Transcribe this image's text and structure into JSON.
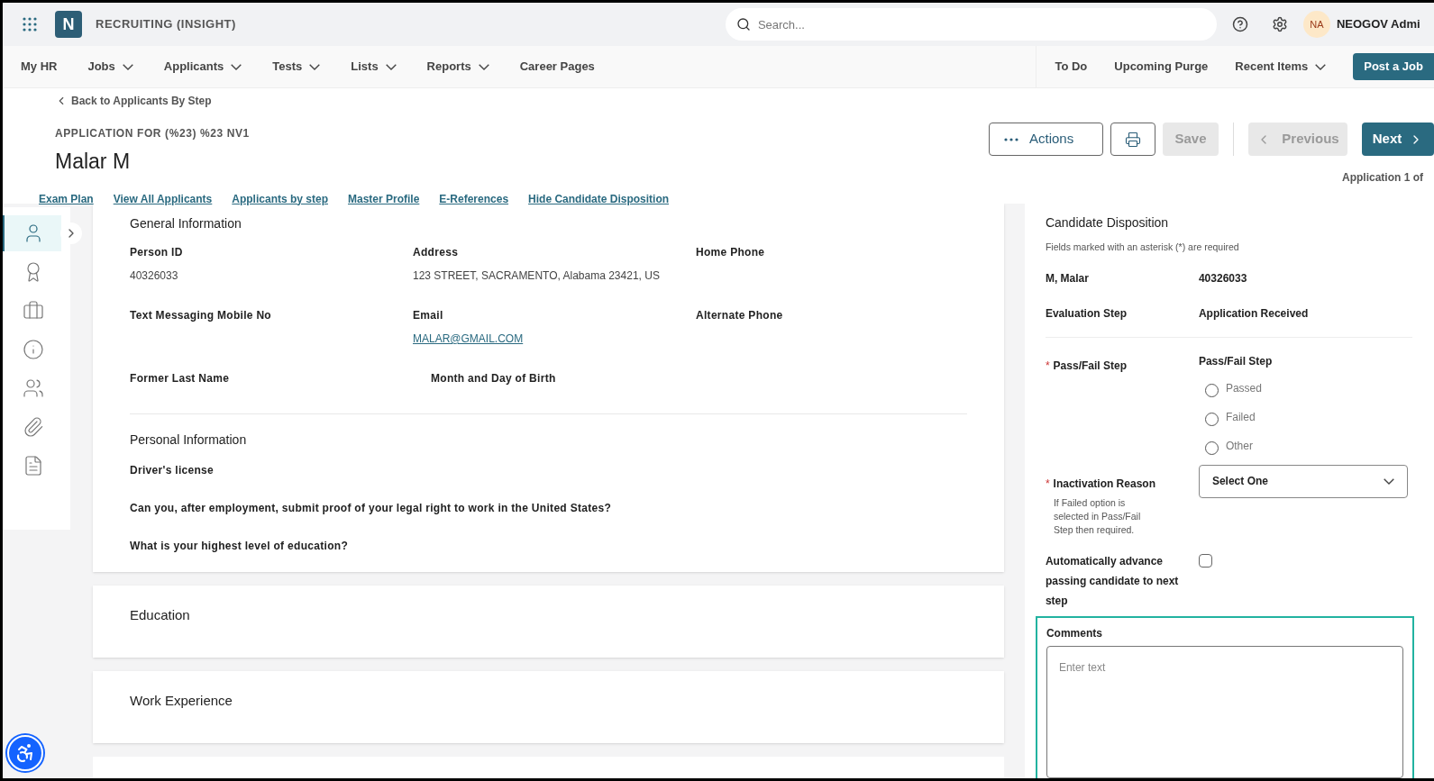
{
  "header": {
    "logo": "N",
    "app_title": "RECRUITING (INSIGHT)",
    "search": {
      "placeholder": "Search..."
    },
    "avatar": "NA",
    "user_name": "NEOGOV Admi"
  },
  "nav": {
    "left": [
      {
        "label": "My HR",
        "dropdown": false
      },
      {
        "label": "Jobs",
        "dropdown": true
      },
      {
        "label": "Applicants",
        "dropdown": true
      },
      {
        "label": "Tests",
        "dropdown": true
      },
      {
        "label": "Lists",
        "dropdown": true
      },
      {
        "label": "Reports",
        "dropdown": true
      },
      {
        "label": "Career Pages",
        "dropdown": false
      }
    ],
    "right": [
      {
        "label": "To Do",
        "dropdown": false
      },
      {
        "label": "Upcoming Purge",
        "dropdown": false
      },
      {
        "label": "Recent Items",
        "dropdown": true
      }
    ],
    "post_button": "Post a Job"
  },
  "page": {
    "back_link": "Back to Applicants By Step",
    "subtitle": "APPLICATION FOR (%23) %23 NV1",
    "name": "Malar M",
    "buttons": [
      {
        "kind": "actions",
        "label": "Actions",
        "disabled": false
      },
      {
        "kind": "print",
        "disabled": false
      },
      {
        "kind": "save",
        "label": "Save",
        "disabled": true
      },
      {
        "kind": "previous",
        "label": "Previous",
        "disabled": true
      },
      {
        "kind": "next",
        "label": "Next",
        "disabled": false
      }
    ],
    "counter": "Application 1 of",
    "links": [
      "Exam Plan",
      "View All Applicants",
      "Applicants by step",
      "Master Profile",
      "E-References",
      "Hide Candidate Disposition"
    ]
  },
  "sidebar": {
    "items": [
      {
        "kind": "person",
        "selected": true
      },
      {
        "kind": "award",
        "selected": false
      },
      {
        "kind": "briefcase",
        "selected": false
      },
      {
        "kind": "info",
        "selected": false
      },
      {
        "kind": "people",
        "selected": false
      },
      {
        "kind": "paperclip",
        "selected": false
      },
      {
        "kind": "document",
        "selected": false
      }
    ]
  },
  "general": {
    "title": "General Information",
    "rows": [
      [
        {
          "label": "Person ID",
          "value": "40326033"
        },
        {
          "label": "Address",
          "value": "123 STREET, SACRAMENTO, Alabama 23421, US"
        },
        {
          "label": "Home Phone"
        }
      ],
      [
        {
          "label": "Text Messaging Mobile No"
        },
        {
          "label": "Email",
          "link": "MALAR@GMAIL.COM"
        },
        {
          "label": "Alternate Phone"
        }
      ],
      [
        {
          "label": "Former Last Name"
        },
        {
          "label": "Month and Day of Birth"
        }
      ]
    ]
  },
  "personal": {
    "title": "Personal Information",
    "questions": [
      "Driver's license",
      "Can you, after employment, submit proof of your legal right to work in the United States?",
      "What is your highest level of education?"
    ]
  },
  "sections": [
    "Education",
    "Work Experience"
  ],
  "disposition": {
    "title": "Candidate Disposition",
    "note": "Fields marked with an asterisk (*) are required",
    "candidate_name": "M, Malar",
    "candidate_id": "40326033",
    "step_label": "Evaluation Step",
    "step_value": "Application Received",
    "pass_fail": {
      "label": "Pass/Fail Step",
      "required_mark": "*",
      "heading": "Pass/Fail Step",
      "options": [
        {
          "label": "Passed",
          "selected": false
        },
        {
          "label": "Failed",
          "selected": false
        },
        {
          "label": "Other",
          "selected": false
        }
      ]
    },
    "inactivation": {
      "label": "Inactivation Reason",
      "required_mark": "*",
      "hint": "If Failed option is selected in Pass/Fail Step then required.",
      "value": "Select One"
    },
    "auto_advance": {
      "label": "Automatically advance passing candidate to next step",
      "checked": false
    },
    "comments": {
      "label": "Comments",
      "placeholder": "Enter text"
    }
  }
}
